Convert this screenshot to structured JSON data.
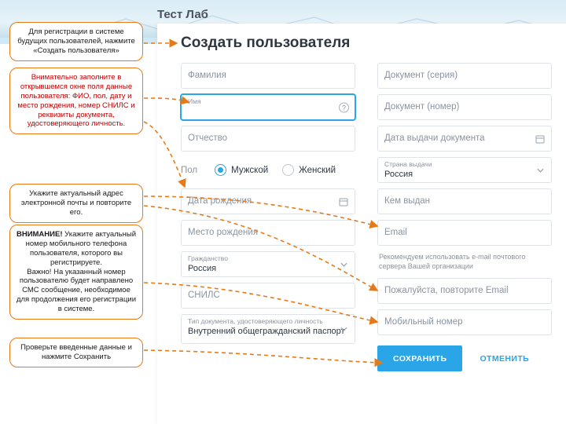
{
  "brand": "Тест Лаб",
  "modal": {
    "title": "Создать пользователя",
    "close": "×"
  },
  "left_fields": {
    "surname": {
      "placeholder": "Фамилия"
    },
    "name": {
      "label": "Имя"
    },
    "patronymic": {
      "placeholder": "Отчество"
    },
    "gender": {
      "label": "Пол",
      "male": "Мужской",
      "female": "Женский"
    },
    "birthdate": {
      "placeholder": "Дата рождения"
    },
    "birthplace": {
      "placeholder": "Место рождения"
    },
    "citizenship": {
      "label": "Гражданство",
      "value": "Россия"
    },
    "snils": {
      "placeholder": "СНИЛС"
    },
    "doctype": {
      "label": "Тип документа, удостоверяющего личность",
      "value": "Внутренний общегражданский паспорт"
    }
  },
  "right_fields": {
    "doc_series": {
      "placeholder": "Документ (серия)"
    },
    "doc_number": {
      "placeholder": "Документ (номер)"
    },
    "doc_date": {
      "placeholder": "Дата выдачи документа"
    },
    "doc_country": {
      "label": "Страна выдачи",
      "value": "Россия"
    },
    "doc_issuer": {
      "placeholder": "Кем выдан"
    },
    "email": {
      "placeholder": "Email"
    },
    "email_hint": "Рекомендуем использовать e-mail почтового сервера Вашей организации",
    "email2": {
      "placeholder": "Пожалуйста, повторите Email"
    },
    "phone": {
      "placeholder": "Мобильный номер"
    }
  },
  "buttons": {
    "save": "СОХРАНИТЬ",
    "cancel": "ОТМЕНИТЬ"
  },
  "callouts": {
    "c1": "Для регистрации в системе будущих пользователей, нажмите «Создать пользователя»",
    "c2": "Внимательно заполните в открывшемся окне поля данные пользователя: ФИО, пол, дату и место рождения, номер СНИЛС и реквизиты документа, удостоверяющего личность.",
    "c3": "Укажите актуальный адрес электронной почты и повторите его.",
    "c4a": "ВНИМАНИЕ! ",
    "c4b": "Укажите актуальный номер мобильного телефона пользователя, которого вы регистрируете.",
    "c4c": "Важно! На указанный номер пользователю будет направлено СМС сообщение, необходимое для продолжения его регистрации в системе.",
    "c5": "Проверьте введенные данные и нажмите Сохранить"
  }
}
